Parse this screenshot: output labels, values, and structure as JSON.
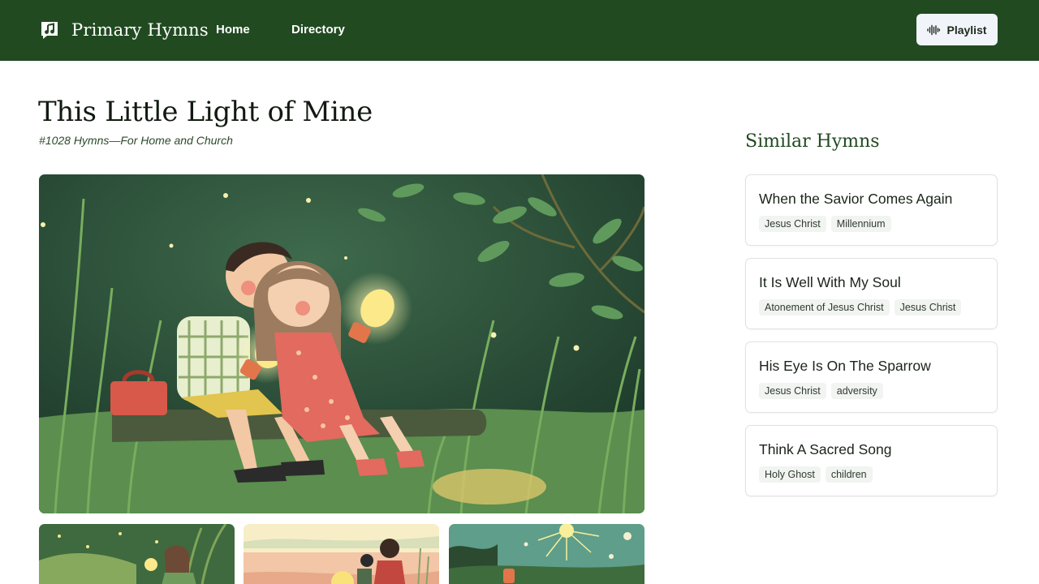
{
  "header": {
    "brand_name": "Primary Hymns",
    "brand_icon": "music-note-icon",
    "nav": [
      {
        "label": "Home"
      },
      {
        "label": "Directory"
      }
    ],
    "playlist_button": {
      "label": "Playlist",
      "icon": "audio-wave-icon"
    }
  },
  "hymn": {
    "title": "This Little Light of Mine",
    "subtitle": "#1028 Hymns—For Home and Church"
  },
  "similar": {
    "heading": "Similar Hymns",
    "items": [
      {
        "title": "When the Savior Comes Again",
        "tags": [
          "Jesus Christ",
          "Millennium"
        ]
      },
      {
        "title": "It Is Well With My Soul",
        "tags": [
          "Atonement of Jesus Christ",
          "Jesus Christ"
        ]
      },
      {
        "title": "His Eye Is On The Sparrow",
        "tags": [
          "Jesus Christ",
          "adversity"
        ]
      },
      {
        "title": "Think A Sacred Song",
        "tags": [
          "Holy Ghost",
          "children"
        ]
      }
    ]
  },
  "colors": {
    "header_bg": "#214a21",
    "accent_green": "#214a21",
    "button_bg": "#f1f4f9",
    "tag_bg": "#f1f4f1"
  }
}
